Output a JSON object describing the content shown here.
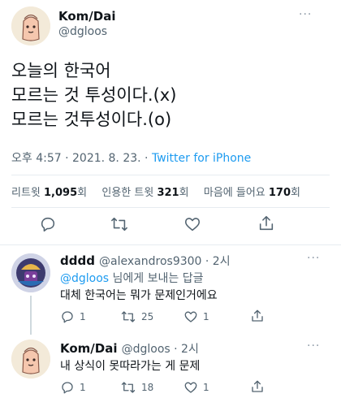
{
  "main_tweet": {
    "author_name": "Kom/Dai",
    "author_handle": "@dgloos",
    "more_label": "···",
    "lines": [
      "오늘의 한국어",
      "모르는 것 투성이다.(x)",
      "모르는 것투성이다.(o)"
    ],
    "timestamp": "오후 4:57 · 2021. 8. 23. · ",
    "source": "Twitter for iPhone",
    "retweets_label": "리트윗 ",
    "retweets_value": "1,095",
    "retweets_unit": "회",
    "quotes_label": "인용한 트윗 ",
    "quotes_value": "321",
    "quotes_unit": "회",
    "likes_label": "마음에 들어요 ",
    "likes_value": "170",
    "likes_unit": "회"
  },
  "replies": [
    {
      "author_name": "dddd",
      "author_handle": "@alexandros9300 · 2시",
      "reply_to_mention": "@dgloos",
      "reply_to_suffix": " 님에게 보내는 답글",
      "text": "대체 한국어는 뭐가 문제인거에요",
      "reply_count": "1",
      "retweet_count": "25",
      "like_count": "1"
    },
    {
      "author_name": "Kom/Dai",
      "author_handle": "@dgloos · 2시",
      "text": "내 상식이 못따라가는 게 문제",
      "reply_count": "1",
      "retweet_count": "18",
      "like_count": "1"
    }
  ],
  "icons": [
    "avatar",
    "reply-icon",
    "retweet-icon",
    "like-icon",
    "share-icon",
    "more-icon"
  ],
  "colors": {
    "link": "#1d9bf0",
    "muted": "#536471",
    "text": "#0f1419",
    "divider": "#e6ecf0"
  }
}
